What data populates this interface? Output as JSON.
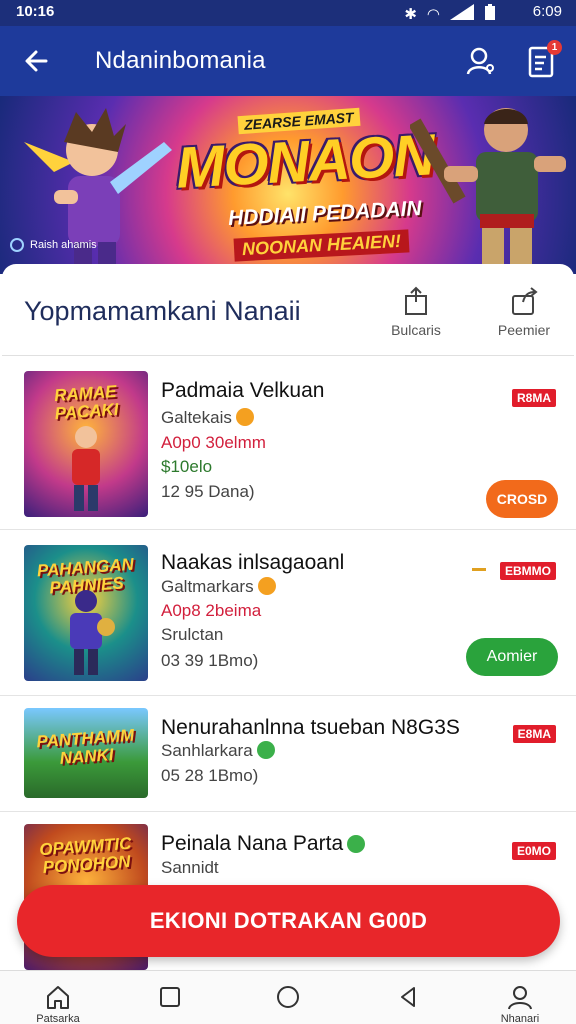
{
  "status_bar": {
    "time": "10:16",
    "clock": "6:09"
  },
  "app_bar": {
    "title": "Ndaninbomania",
    "notification_count": "1"
  },
  "banner": {
    "tag": "ZEARSE EMAST",
    "headline": "MONAON",
    "subline1": "HDDIAII PEDADAIN",
    "subline2": "NOONAN HEAIEN!",
    "corner_label": "Raish ahamis"
  },
  "section": {
    "heading": "Yopmamamkani Nanaii",
    "actions": [
      {
        "label": "Bulcaris",
        "icon": "share-icon"
      },
      {
        "label": "Peemier",
        "icon": "share-alt-icon"
      }
    ]
  },
  "games": [
    {
      "thumb_title": "RAMAE PACAKI",
      "name": "Padmaia Velkuan",
      "publisher": "Galtekais",
      "promo": "A0p0 30elmm",
      "price": "$10elo",
      "meta": "12 95 Dana)",
      "badge": "R8MA",
      "button": "CROSD",
      "colors": {
        "thumb_bg": "#7b2ea8"
      }
    },
    {
      "thumb_title": "PAHANGAN PAHNIES",
      "name": "Naakas inlsagaoanl",
      "publisher": "Galtmarkars",
      "promo": "A0p8 2beima",
      "price": "Srulctan",
      "meta": "03 39 1Bmo)",
      "badge": "EBMMO",
      "button": "Aomier",
      "colors": {
        "thumb_bg": "#1b8f8a"
      }
    },
    {
      "thumb_title": "PANTHAMM NANKI",
      "name": "Nenurahanlnna tsueban N8G3S",
      "publisher": "Sanhlarkara",
      "meta": "05 28 1Bmo)",
      "badge": "E8MA",
      "colors": {
        "thumb_bg": "#3b9a3a"
      }
    },
    {
      "thumb_title": "OPAWMTIC PONOHON",
      "name": "Peinala Nana Parta",
      "publisher": "Sannidt",
      "badge": "E0MO",
      "colors": {
        "thumb_bg": "#c04a1e"
      }
    }
  ],
  "cta": {
    "label": "EKIONI DOTRAKAN G00D"
  },
  "bottom_nav": [
    {
      "label": "Patsarka",
      "icon": "home-icon"
    },
    {
      "label": "",
      "icon": "square-icon"
    },
    {
      "label": "",
      "icon": "circle-icon"
    },
    {
      "label": "",
      "icon": "back-triangle-icon"
    },
    {
      "label": "Nhanari",
      "icon": "profile-icon"
    }
  ],
  "colors": {
    "primary": "#1e3a9b",
    "accent_red": "#e8262a",
    "badge_red": "#e11d2b",
    "button_orange": "#f26a1b",
    "button_green": "#2aa33c"
  }
}
